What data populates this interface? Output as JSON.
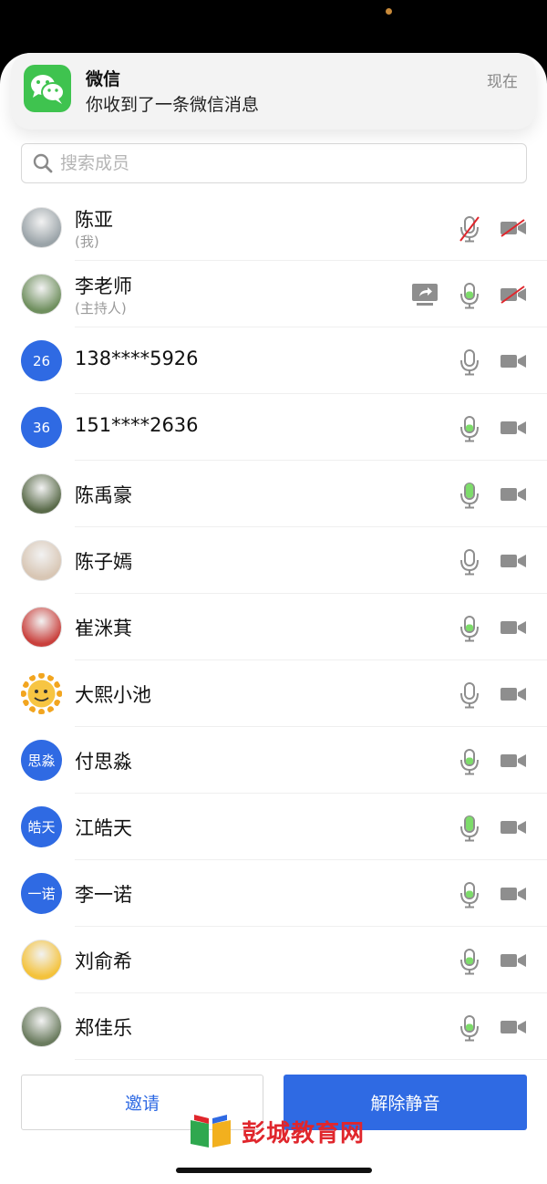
{
  "notification": {
    "app": "微信",
    "message": "你收到了一条微信消息",
    "time": "现在",
    "icon": "wechat-icon"
  },
  "search": {
    "placeholder": "搜索成员"
  },
  "members": [
    {
      "name": "陈亚",
      "role": "(我)",
      "avatar": "photo",
      "mic": "muted",
      "camera": "off",
      "share": false
    },
    {
      "name": "李老师",
      "role": "(主持人)",
      "avatar": "photo",
      "mic": "active",
      "camera": "off",
      "share": true
    },
    {
      "name": "138****5926",
      "role": "",
      "avatar_text": "26",
      "mic": "idle",
      "camera": "on",
      "share": false
    },
    {
      "name": "151****2636",
      "role": "",
      "avatar_text": "36",
      "mic": "active",
      "camera": "on",
      "share": false
    },
    {
      "name": "陈禹豪",
      "role": "",
      "avatar": "photo",
      "mic": "speaking",
      "camera": "on",
      "share": false
    },
    {
      "name": "陈子嫣",
      "role": "",
      "avatar": "photo",
      "mic": "idle",
      "camera": "on",
      "share": false
    },
    {
      "name": "崔洣萁",
      "role": "",
      "avatar": "photo",
      "mic": "active",
      "camera": "on",
      "share": false
    },
    {
      "name": "大熙小池",
      "role": "",
      "avatar": "sun",
      "mic": "idle",
      "camera": "on",
      "share": false
    },
    {
      "name": "付思淼",
      "role": "",
      "avatar_text": "思淼",
      "mic": "active",
      "camera": "on",
      "share": false
    },
    {
      "name": "江皓天",
      "role": "",
      "avatar_text": "皓天",
      "mic": "speaking",
      "camera": "on",
      "share": false
    },
    {
      "name": "李一诺",
      "role": "",
      "avatar_text": "一诺",
      "mic": "active",
      "camera": "on",
      "share": false
    },
    {
      "name": "刘俞希",
      "role": "",
      "avatar": "photo",
      "mic": "active",
      "camera": "on",
      "share": false
    },
    {
      "name": "郑佳乐",
      "role": "",
      "avatar": "photo",
      "mic": "active",
      "camera": "on",
      "share": false
    }
  ],
  "buttons": {
    "invite": "邀请",
    "unmute": "解除静音"
  },
  "watermark": "彭城教育网",
  "colors": {
    "accent": "#2f6ae3",
    "mic_green": "#7ddc6a",
    "icon_gray": "#8e8e8e",
    "muted_red": "#e0262c"
  }
}
